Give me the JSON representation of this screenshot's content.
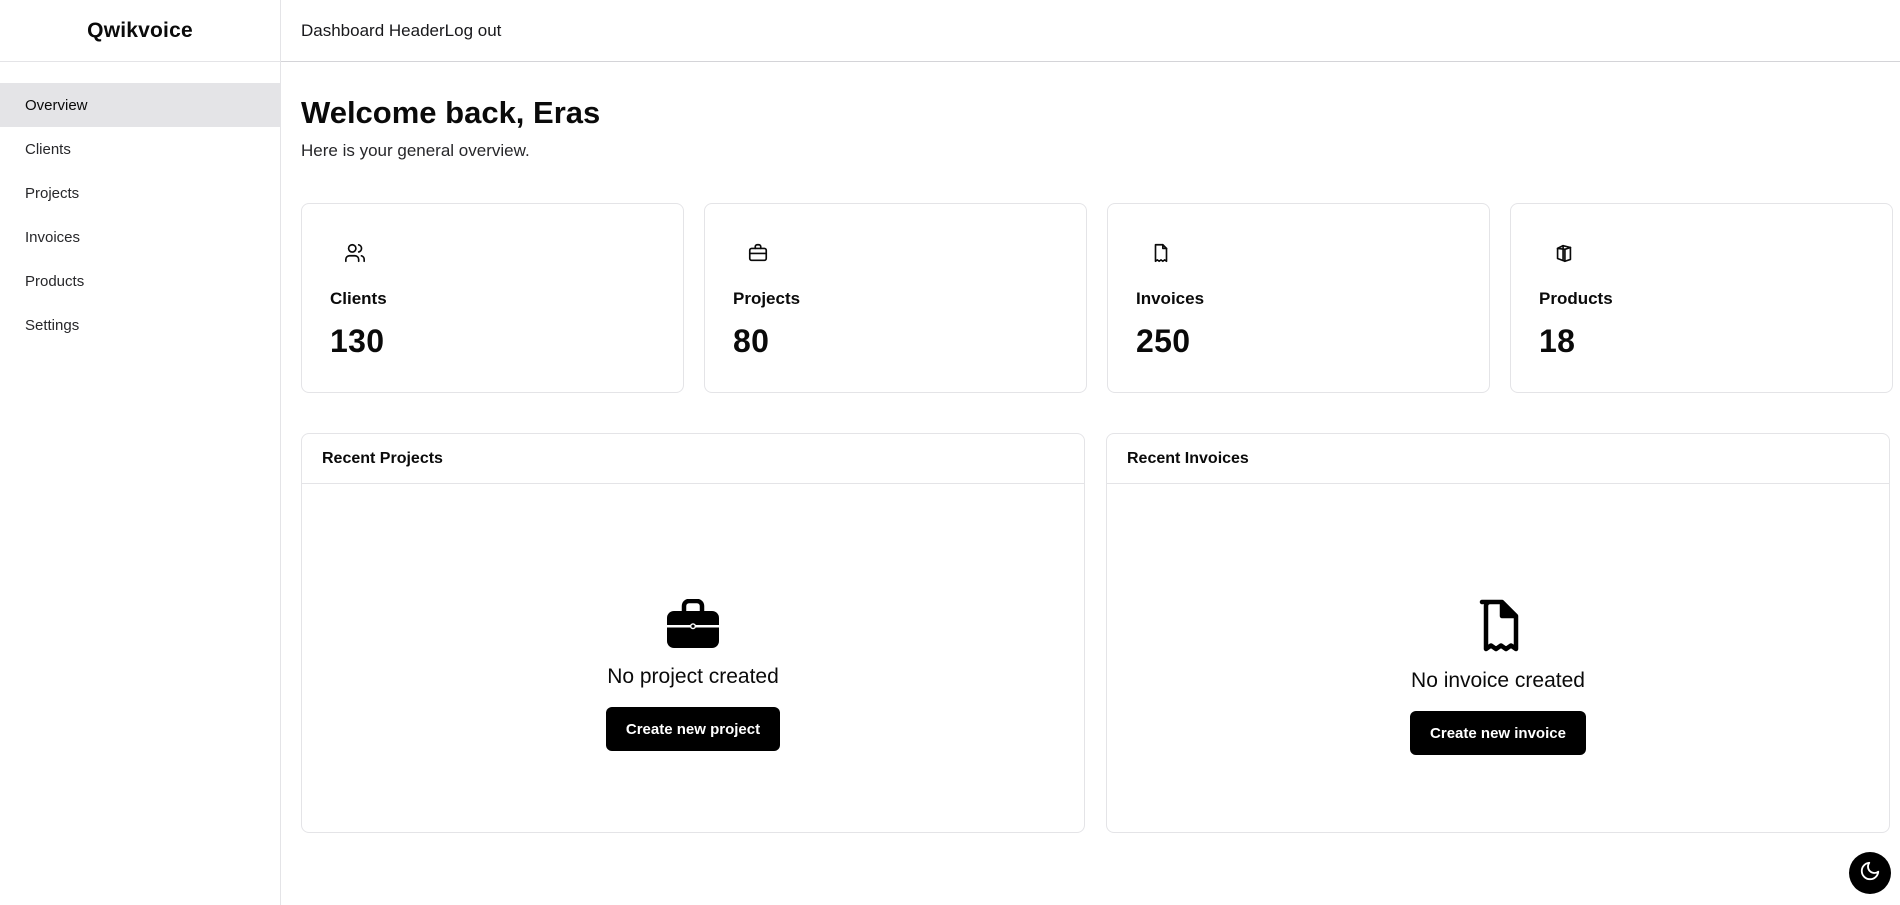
{
  "sidebar": {
    "brand": "Qwikvoice",
    "items": [
      {
        "label": "Overview",
        "active": true
      },
      {
        "label": "Clients",
        "active": false
      },
      {
        "label": "Projects",
        "active": false
      },
      {
        "label": "Invoices",
        "active": false
      },
      {
        "label": "Products",
        "active": false
      },
      {
        "label": "Settings",
        "active": false
      }
    ]
  },
  "header": {
    "title": "Dashboard Header",
    "logout_label": "Log out"
  },
  "main": {
    "welcome": "Welcome back, Eras",
    "subtitle": "Here is your general overview.",
    "stats": [
      {
        "label": "Clients",
        "value": "130",
        "icon": "users-icon"
      },
      {
        "label": "Projects",
        "value": "80",
        "icon": "briefcase-icon"
      },
      {
        "label": "Invoices",
        "value": "250",
        "icon": "receipt-icon"
      },
      {
        "label": "Products",
        "value": "18",
        "icon": "boxes-icon"
      }
    ],
    "recent_projects": {
      "title": "Recent Projects",
      "empty_text": "No project created",
      "button_label": "Create new project",
      "icon": "briefcase-icon"
    },
    "recent_invoices": {
      "title": "Recent Invoices",
      "empty_text": "No invoice created",
      "button_label": "Create new invoice",
      "icon": "receipt-icon"
    }
  },
  "theme_toggle": {
    "icon": "moon-icon"
  },
  "colors": {
    "border": "#e4e4e7",
    "active_nav": "#e4e4e7",
    "button_bg": "#000000",
    "text": "#0a0a0a"
  }
}
